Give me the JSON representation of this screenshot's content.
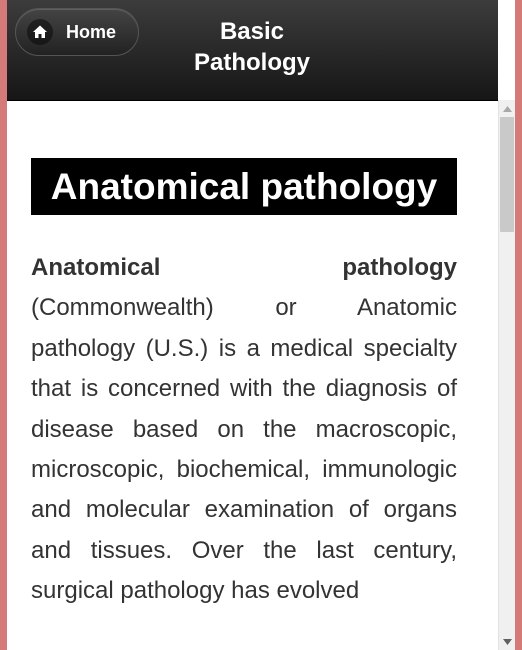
{
  "header": {
    "home_label": "Home",
    "title_line1": "Basic",
    "title_line2": "Pathology"
  },
  "content": {
    "heading": "Anatomical pathology",
    "paragraph_bold": "Anatomical pathology",
    "paragraph_rest": " (Commonwealth) or Anatomic pathology (U.S.) is a medical specialty that is concerned with the diagnosis of disease based on the macroscopic, microscopic, biochemical, immunologic and molecular examination of organs and tissues. Over the last century, surgical pathology has evolved"
  },
  "colors": {
    "header_bg": "#222222",
    "heading_bg": "#000000",
    "body_text": "#333333",
    "window_border": "#d47a78"
  },
  "icons": {
    "home": "home-icon",
    "scroll_up": "scroll-up-arrow-icon",
    "scroll_down": "scroll-down-arrow-icon"
  }
}
